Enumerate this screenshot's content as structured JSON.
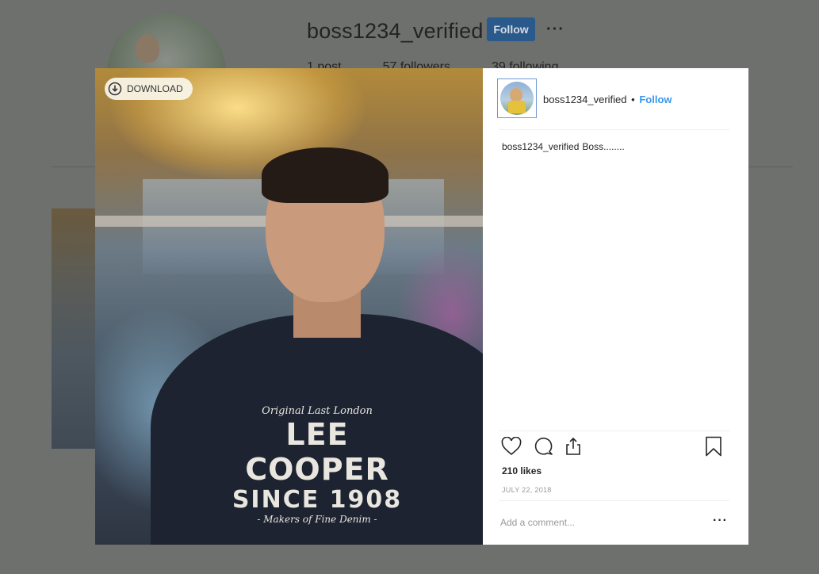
{
  "profile": {
    "username": "boss1234_verified",
    "follow_label": "Follow",
    "more_label": "···",
    "stats": [
      "1 post",
      "57 followers",
      "39 following"
    ]
  },
  "modal": {
    "download_label": "DOWNLOAD",
    "shirt_text": {
      "line1": "Original  Last London",
      "brand": "LEE COOPER",
      "since": "SINCE 1908",
      "line2": "- Makers of Fine Denim -"
    },
    "header": {
      "username": "boss1234_verified",
      "separator": "•",
      "follow_label": "Follow"
    },
    "caption": {
      "username": "boss1234_verified",
      "text": "Boss........"
    },
    "likes": "210 likes",
    "date": "JULY 22, 2018",
    "comment_placeholder": "Add a comment...",
    "comment_more": "···"
  },
  "colors": {
    "overlay_bg": "#6e706d",
    "follow_link": "#3897f0",
    "follow_button_dim": "#2a5a8c"
  },
  "icons": [
    "download-icon",
    "heart-icon",
    "comment-icon",
    "share-icon",
    "bookmark-icon"
  ]
}
